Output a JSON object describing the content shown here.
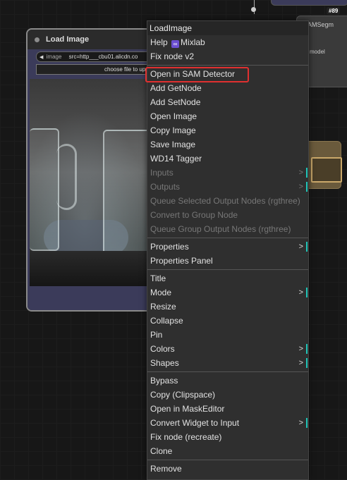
{
  "node": {
    "title": "Load Image",
    "image_widget_label": "image",
    "image_widget_value": "src=http___cbu01.alicdn.co",
    "upload_button": "choose file to up"
  },
  "bg_nodes": {
    "right_node_label": "oSAMSegm",
    "right_node_sub": "model",
    "badge": "#89"
  },
  "menu": {
    "title": "LoadImage",
    "help_label": "Help",
    "mixlab_label": "Mixlab",
    "items_group1": [
      {
        "label": "Fix node v2"
      }
    ],
    "items_group2": [
      {
        "label": "Open in SAM Detector"
      },
      {
        "label": "Add GetNode"
      },
      {
        "label": "Add SetNode"
      },
      {
        "label": "Open Image"
      },
      {
        "label": "Copy Image"
      },
      {
        "label": "Save Image"
      },
      {
        "label": "WD14 Tagger"
      },
      {
        "label": "Inputs",
        "disabled": true,
        "submenu": true
      },
      {
        "label": "Outputs",
        "disabled": true,
        "submenu": true
      },
      {
        "label": "Queue Selected Output Nodes (rgthree)",
        "disabled": true
      },
      {
        "label": "Convert to Group Node",
        "disabled": true
      },
      {
        "label": "Queue Group Output Nodes (rgthree)",
        "disabled": true
      }
    ],
    "items_group3": [
      {
        "label": "Properties",
        "submenu": true
      },
      {
        "label": "Properties Panel"
      }
    ],
    "items_group4": [
      {
        "label": "Title"
      },
      {
        "label": "Mode",
        "submenu": true
      },
      {
        "label": "Resize"
      },
      {
        "label": "Collapse"
      },
      {
        "label": "Pin"
      },
      {
        "label": "Colors",
        "submenu": true
      },
      {
        "label": "Shapes",
        "submenu": true
      }
    ],
    "items_group5": [
      {
        "label": "Bypass"
      },
      {
        "label": "Copy (Clipspace)"
      },
      {
        "label": "Open in MaskEditor"
      },
      {
        "label": "Convert Widget to Input",
        "submenu": true
      },
      {
        "label": "Fix node (recreate)"
      },
      {
        "label": "Clone"
      }
    ],
    "items_group6": [
      {
        "label": "Remove"
      }
    ],
    "submenu_arrow": ">"
  },
  "colors": {
    "highlight_box": "#e03030",
    "submenu_accent": "#20c5b8"
  }
}
